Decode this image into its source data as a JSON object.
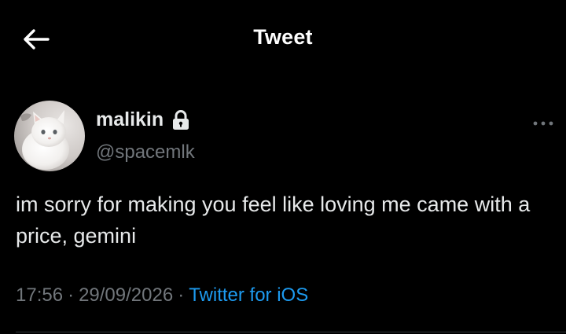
{
  "header": {
    "title": "Tweet",
    "back_icon": "arrow-left-icon"
  },
  "tweet": {
    "author": {
      "display_name": "malikin",
      "handle": "@spacemlk",
      "protected": true,
      "lock_icon": "lock-icon",
      "avatar": "white-cat-photo"
    },
    "more_icon": "more-horizontal-icon",
    "text": "im sorry for making you feel like loving me came with a price, gemini",
    "time": "17:56",
    "date": "29/09/2026",
    "separator": "·",
    "source": "Twitter for iOS"
  },
  "colors": {
    "background": "#000000",
    "primary_text": "#e7e9ea",
    "secondary_text": "#71767b",
    "link": "#1d9bf0",
    "divider": "#2f3336"
  }
}
